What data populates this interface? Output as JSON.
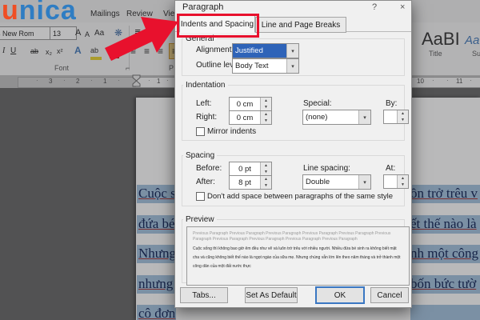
{
  "logo": {
    "part1": "u",
    "part2": "nica"
  },
  "ribbon": {
    "tabs": [
      {
        "label": "Mailings"
      },
      {
        "label": "Review"
      },
      {
        "label": "View"
      }
    ],
    "font_name": "s New Rom",
    "font_size": "13",
    "grow_font": "A",
    "shrink_font": "A",
    "change_case": "Aa",
    "clear_format": "❋",
    "italic": "I",
    "underline": "U",
    "strikethrough": "ab",
    "subscript": "x₂",
    "superscript": "x²",
    "text_effects": "A",
    "highlight": "ab",
    "font_color": "A",
    "align_icon": "≡",
    "bullets_icon": "≣",
    "font_group_label": "Font",
    "paragraph_group_label": "P",
    "styles": [
      {
        "sample": "AaBI",
        "label": "Title"
      },
      {
        "sample": "AaB",
        "label": "Su"
      }
    ]
  },
  "ruler": {
    "n3": "3",
    "n2": "2",
    "n1": "1",
    "p1": "1",
    "p10": "10",
    "p11": "11",
    "dot": "·"
  },
  "document": {
    "lines": [
      {
        "left": "Cuộc s",
        "right": "ồn trở trêu v"
      },
      {
        "left": "đứa bé",
        "right": "ết thế nào là"
      },
      {
        "left": "Nhưng",
        "right": "nh một công"
      },
      {
        "left": "nhưng",
        "right": "bốn bức tườ"
      },
      {
        "left": "cô đơn",
        "right": ""
      }
    ]
  },
  "dialog": {
    "title": "Paragraph",
    "tabs": [
      {
        "label": "Indents and Spacing"
      },
      {
        "label": "Line and Page Breaks"
      }
    ],
    "general": {
      "label": "General",
      "alignment_label": "Alignment:",
      "alignment_value": "Justified",
      "outline_label": "Outline level:",
      "outline_value": "Body Text"
    },
    "indentation": {
      "label": "Indentation",
      "left_label": "Left:",
      "left_value": "0 cm",
      "right_label": "Right:",
      "right_value": "0 cm",
      "special_label": "Special:",
      "special_value": "(none)",
      "by_label": "By:",
      "by_value": "",
      "mirror_label": "Mirror indents"
    },
    "spacing": {
      "label": "Spacing",
      "before_label": "Before:",
      "before_value": "0 pt",
      "after_label": "After:",
      "after_value": "8 pt",
      "line_spacing_label": "Line spacing:",
      "line_spacing_value": "Double",
      "at_label": "At:",
      "at_value": "",
      "dont_add_label": "Don't add space between paragraphs of the same style"
    },
    "preview": {
      "label": "Preview",
      "gray_text": "Previous Paragraph Previous Paragraph Previous Paragraph Previous Paragraph Previous Paragraph Previous Paragraph Previous Paragraph Previous Paragraph Previous Paragraph Previous Paragraph",
      "sample_text": "Cuộc sống thì không bao giờ êm đều như vẽ và luôn trớ trêu với nhiều người. Nhiều đứa bé sinh ra không biết mặt cha và cũng không biết thế nào là ngọt ngào của sữa mẹ. Nhưng chúng vẫn lớn lên theo năm tháng và trở thành một công dân của một đất nước thực"
    },
    "buttons": {
      "tabs": "Tabs...",
      "set_default": "Set As Default",
      "ok": "OK",
      "cancel": "Cancel"
    }
  },
  "icons": {
    "chevron_down": "▾",
    "spin_up": "▲",
    "spin_down": "▼",
    "help": "?",
    "close": "×"
  },
  "colors": {
    "arrow_red": "#e8112d",
    "selection_blue": "#a8c4de",
    "accent_blue": "#2e63b8"
  }
}
